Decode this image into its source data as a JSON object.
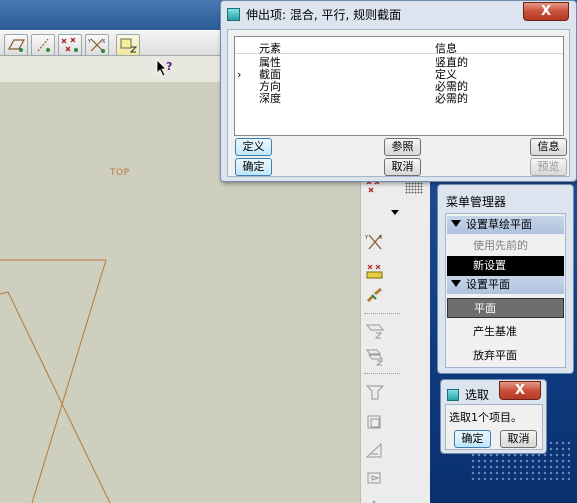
{
  "canvas": {
    "view_label": "TOP"
  },
  "element_dialog": {
    "title": "伸出项: 混合, 平行, 规则截面",
    "close_label": "X",
    "columns": {
      "element": "元素",
      "info": "信息"
    },
    "rows": [
      {
        "marker": "",
        "element": "属性",
        "info": "竖直的"
      },
      {
        "marker": "›",
        "element": "截面",
        "info": "定义"
      },
      {
        "marker": "",
        "element": "方向",
        "info": "必需的"
      },
      {
        "marker": "",
        "element": "深度",
        "info": "必需的"
      }
    ],
    "buttons": {
      "define": "定义",
      "reference": "参照",
      "info": "信息",
      "ok": "确定",
      "cancel": "取消",
      "preview": "预览"
    }
  },
  "menu_manager": {
    "title": "菜单管理器",
    "section1": {
      "header": "设置草绘平面",
      "items": [
        "使用先前的",
        "新设置"
      ]
    },
    "section2": {
      "header": "设置平面",
      "items": [
        "平面",
        "产生基准",
        "放弃平面"
      ]
    }
  },
  "select_dialog": {
    "title": "选取",
    "close_label": "X",
    "message": "选取1个项目。",
    "ok": "确定",
    "cancel": "取消"
  },
  "colors": {
    "sketch_line": "#b37a3a",
    "dialog_bg": "#dbe4ef",
    "close_red": "#c9503a",
    "selected_item": "#000000"
  },
  "icons": [
    "plane-icon",
    "point-icon",
    "csys-icon",
    "axis-icon",
    "datum-layer-icon",
    "help-cursor-icon"
  ]
}
